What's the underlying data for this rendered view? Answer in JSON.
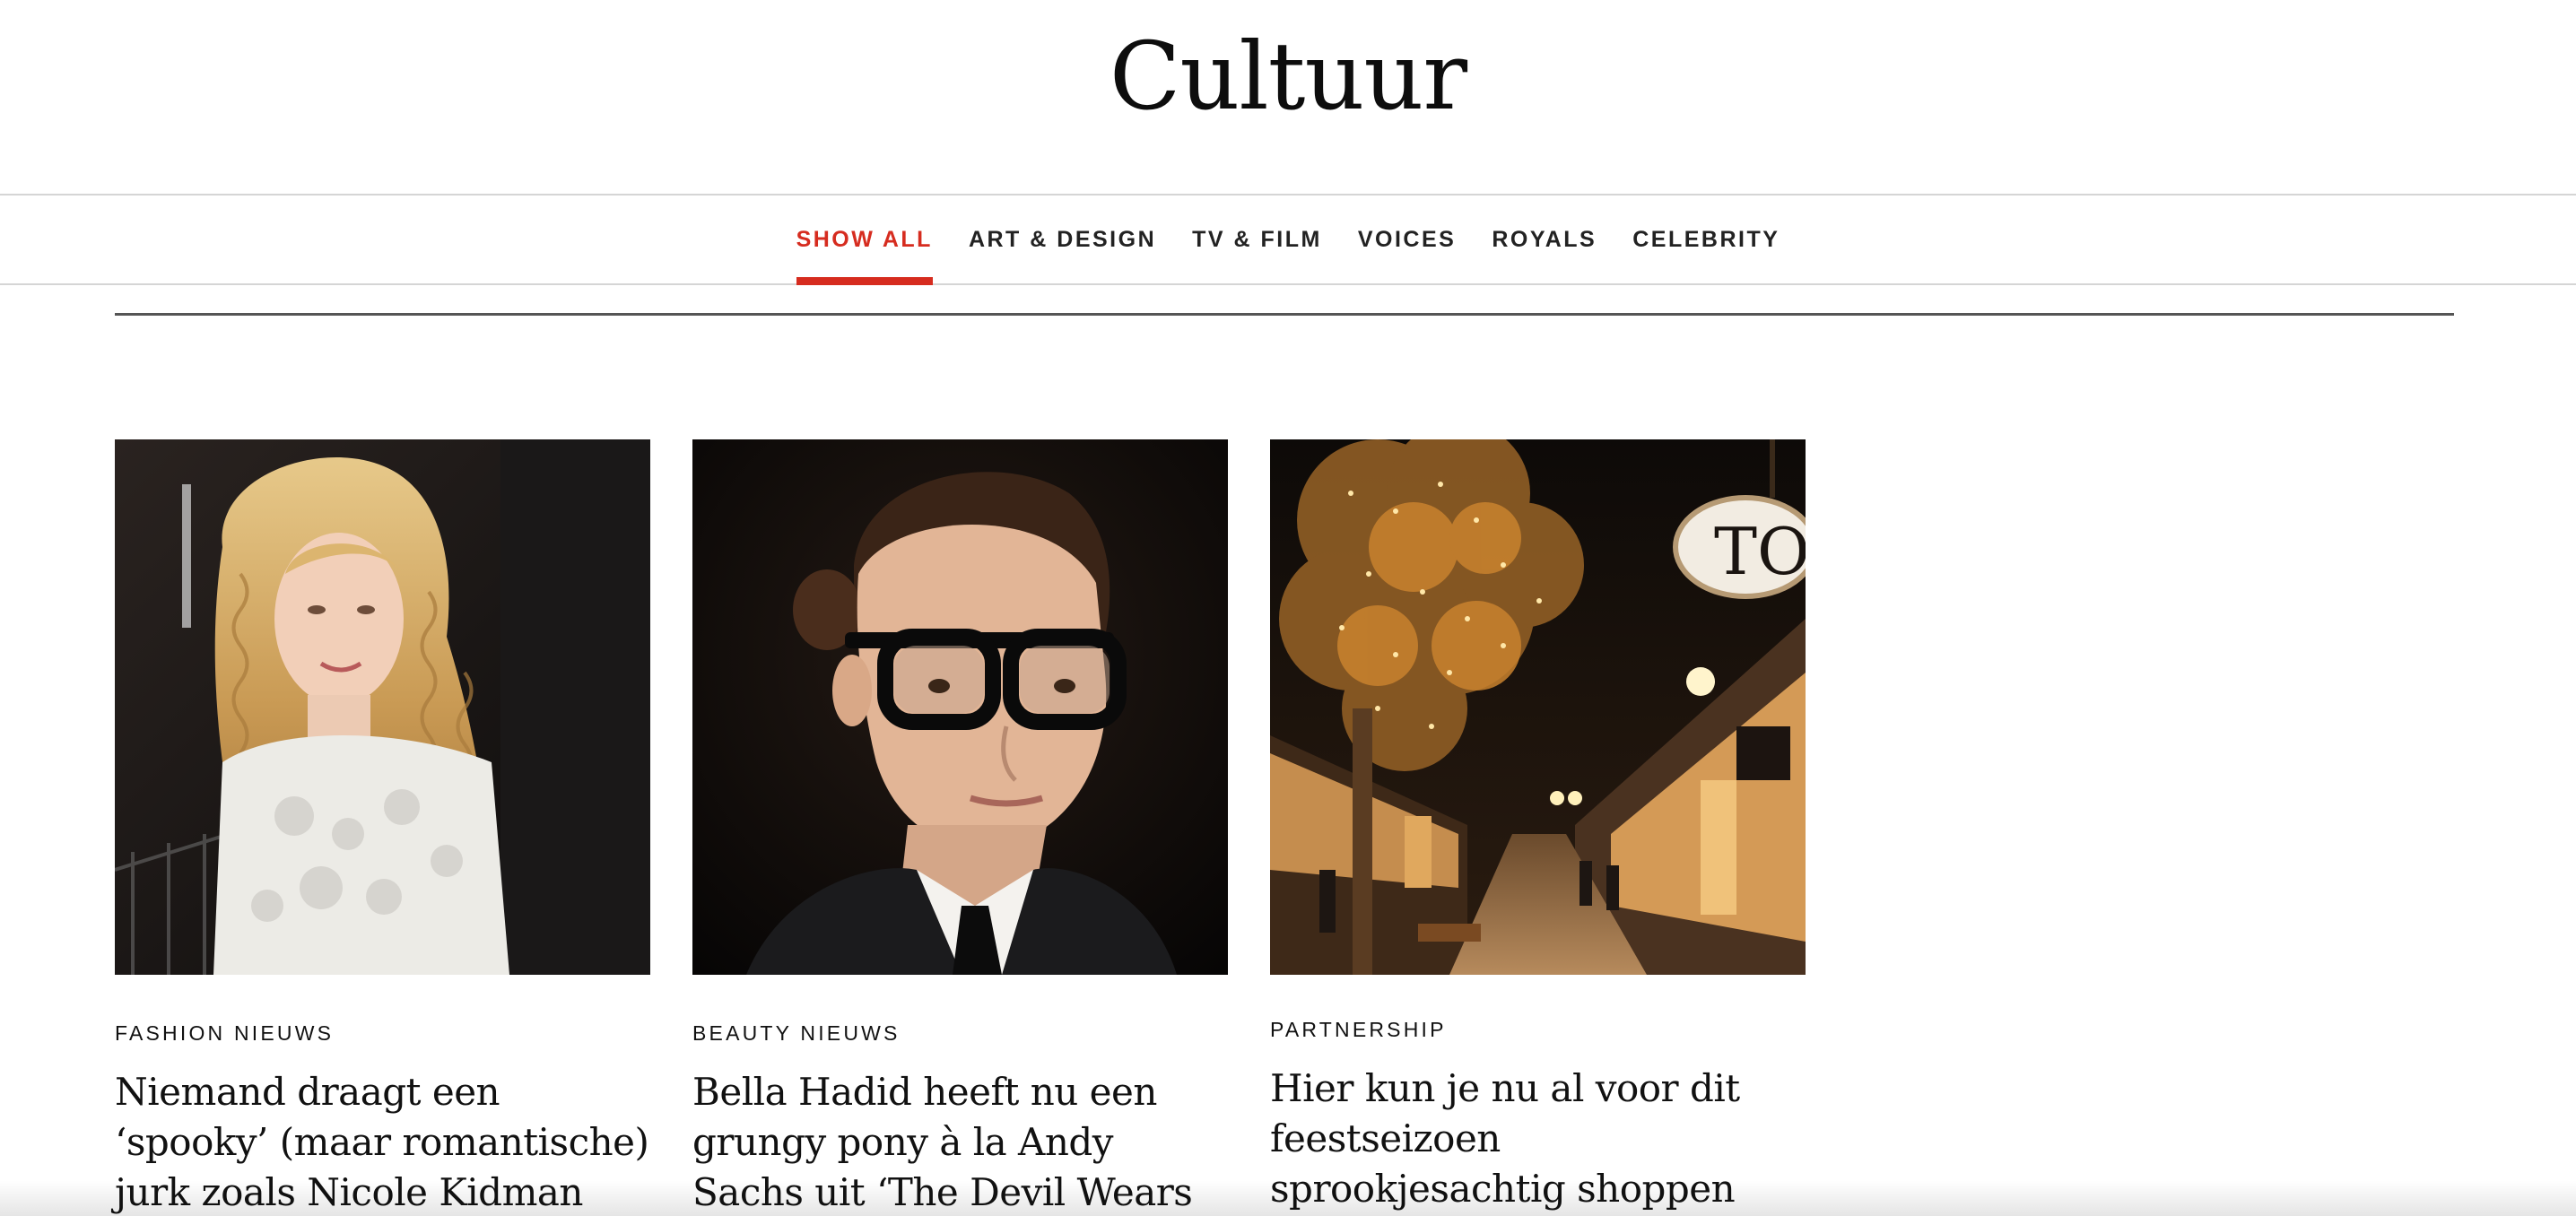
{
  "page": {
    "title": "Cultuur"
  },
  "nav": {
    "items": [
      {
        "label": "SHOW ALL",
        "active": true
      },
      {
        "label": "ART & DESIGN",
        "active": false
      },
      {
        "label": "TV & FILM",
        "active": false
      },
      {
        "label": "VOICES",
        "active": false
      },
      {
        "label": "ROYALS",
        "active": false
      },
      {
        "label": "CELEBRITY",
        "active": false
      }
    ]
  },
  "colors": {
    "accent": "#d62c1f",
    "text": "#111111",
    "divider": "#d5d5d5"
  },
  "articles": [
    {
      "kicker": "FASHION NIEUWS",
      "headline": "Niemand draagt een ‘spooky’ (maar romantische) jurk zoals Nicole Kidman dat doet",
      "image": "woman-long-blonde-wavy-hair-white-lace-dress"
    },
    {
      "kicker": "BEAUTY NIEUWS",
      "headline": "Bella Hadid heeft nu een grungy pony à la Andy Sachs uit ‘The Devil Wears Prada’",
      "image": "woman-black-glasses-slicked-bun-black-suit"
    },
    {
      "kicker": "PARTNERSHIP",
      "headline": "Hier kun je nu al voor dit feestseizoen sprookjesachtig shoppen",
      "image": "shopping-street-at-night-with-lit-trees"
    }
  ]
}
